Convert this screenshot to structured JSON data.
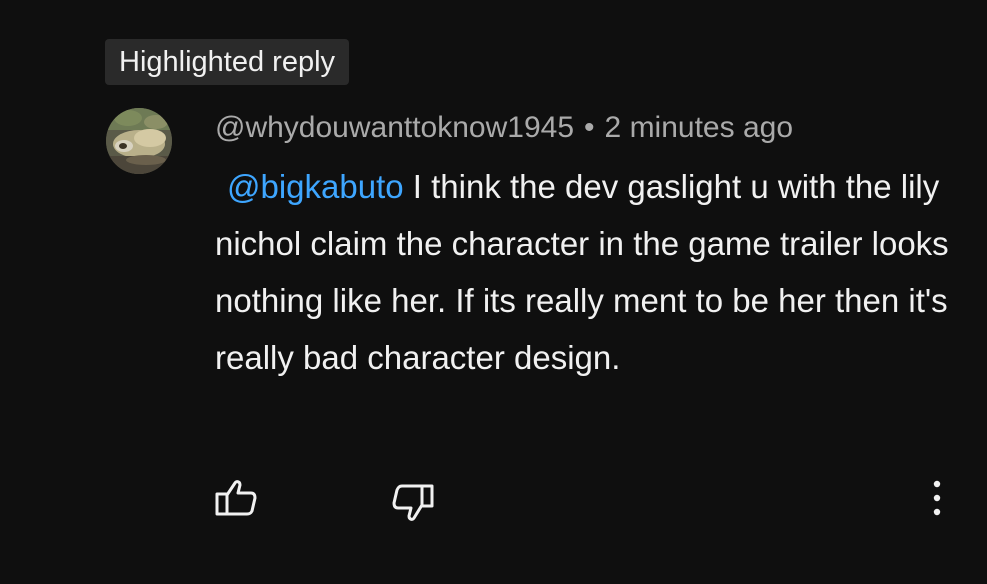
{
  "badge": {
    "label": "Highlighted reply"
  },
  "comment": {
    "author": "@whydouwanttoknow1945",
    "separator": "•",
    "time": "2 minutes ago",
    "mention": "@bigkabuto",
    "text": " I think the dev gaslight u with the lily nichol claim the character in the game trailer looks nothing like her. If its really ment to be her then it's really bad character design."
  },
  "actions": {
    "like_icon": "thumbs-up-icon",
    "dislike_icon": "thumbs-down-icon",
    "more_icon": "more-vert-icon"
  },
  "colors": {
    "background": "#0f0f0f",
    "badge_bg": "#2a2a2a",
    "text": "#f1f1f1",
    "muted": "#aaaaaa",
    "mention": "#3ea6ff"
  }
}
